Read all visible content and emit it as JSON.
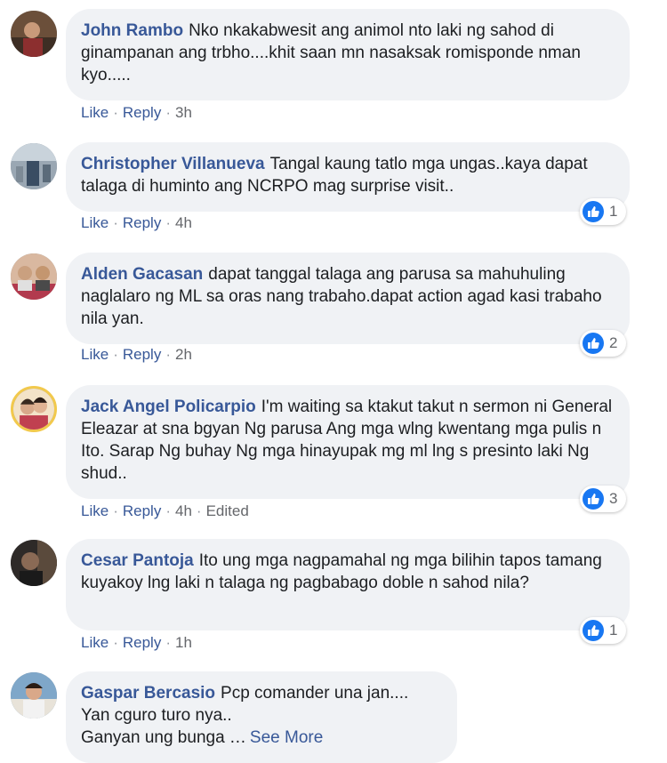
{
  "comments": [
    {
      "author": "John Rambo",
      "text": "Nko nkakabwesit ang animol nto laki ng sahod di ginampanan ang trbho....khit saan mn nasaksak romisponde nman kyo.....",
      "like": "Like",
      "reply": "Reply",
      "time": "3h"
    },
    {
      "author": "Christopher Villanueva",
      "text": "Tangal kaung tatlo mga ungas..kaya dapat talaga di huminto ang NCRPO mag surprise visit..",
      "like": "Like",
      "reply": "Reply",
      "time": "4h",
      "reactions": "1"
    },
    {
      "author": "Alden Gacasan",
      "text": "dapat tanggal talaga ang parusa sa mahuhuling naglalaro ng ML sa oras nang trabaho.dapat action agad kasi trabaho nila yan.",
      "like": "Like",
      "reply": "Reply",
      "time": "2h",
      "reactions": "2"
    },
    {
      "author": "Jack Angel Policarpio",
      "text": "I'm waiting sa ktakut takut n sermon ni General Eleazar at sna bgyan Ng parusa Ang mga wlng kwentang mga pulis n Ito. Sarap Ng buhay Ng mga hinayupak mg ml lng s presinto laki Ng shud..",
      "like": "Like",
      "reply": "Reply",
      "time": "4h",
      "edited": "Edited",
      "reactions": "3"
    },
    {
      "author": "Cesar Pantoja",
      "text": "Ito ung mga nagpamahal ng mga bilihin tapos tamang kuyakoy lng laki n talaga ng pagbabago doble n sahod nila?",
      "like": "Like",
      "reply": "Reply",
      "time": "1h",
      "reactions": "1"
    },
    {
      "author": "Gaspar Bercasio",
      "text_lines": [
        "Pcp comander una jan....",
        "Yan cguro turo nya..",
        "Ganyan ung bunga …"
      ],
      "see_more": "See More"
    }
  ],
  "colors": {
    "author": "#385898",
    "bubble": "#f0f2f5",
    "like_blue": "#1877f2",
    "meta": "#65676b"
  },
  "icons": {
    "reaction": "like-thumb-icon"
  }
}
